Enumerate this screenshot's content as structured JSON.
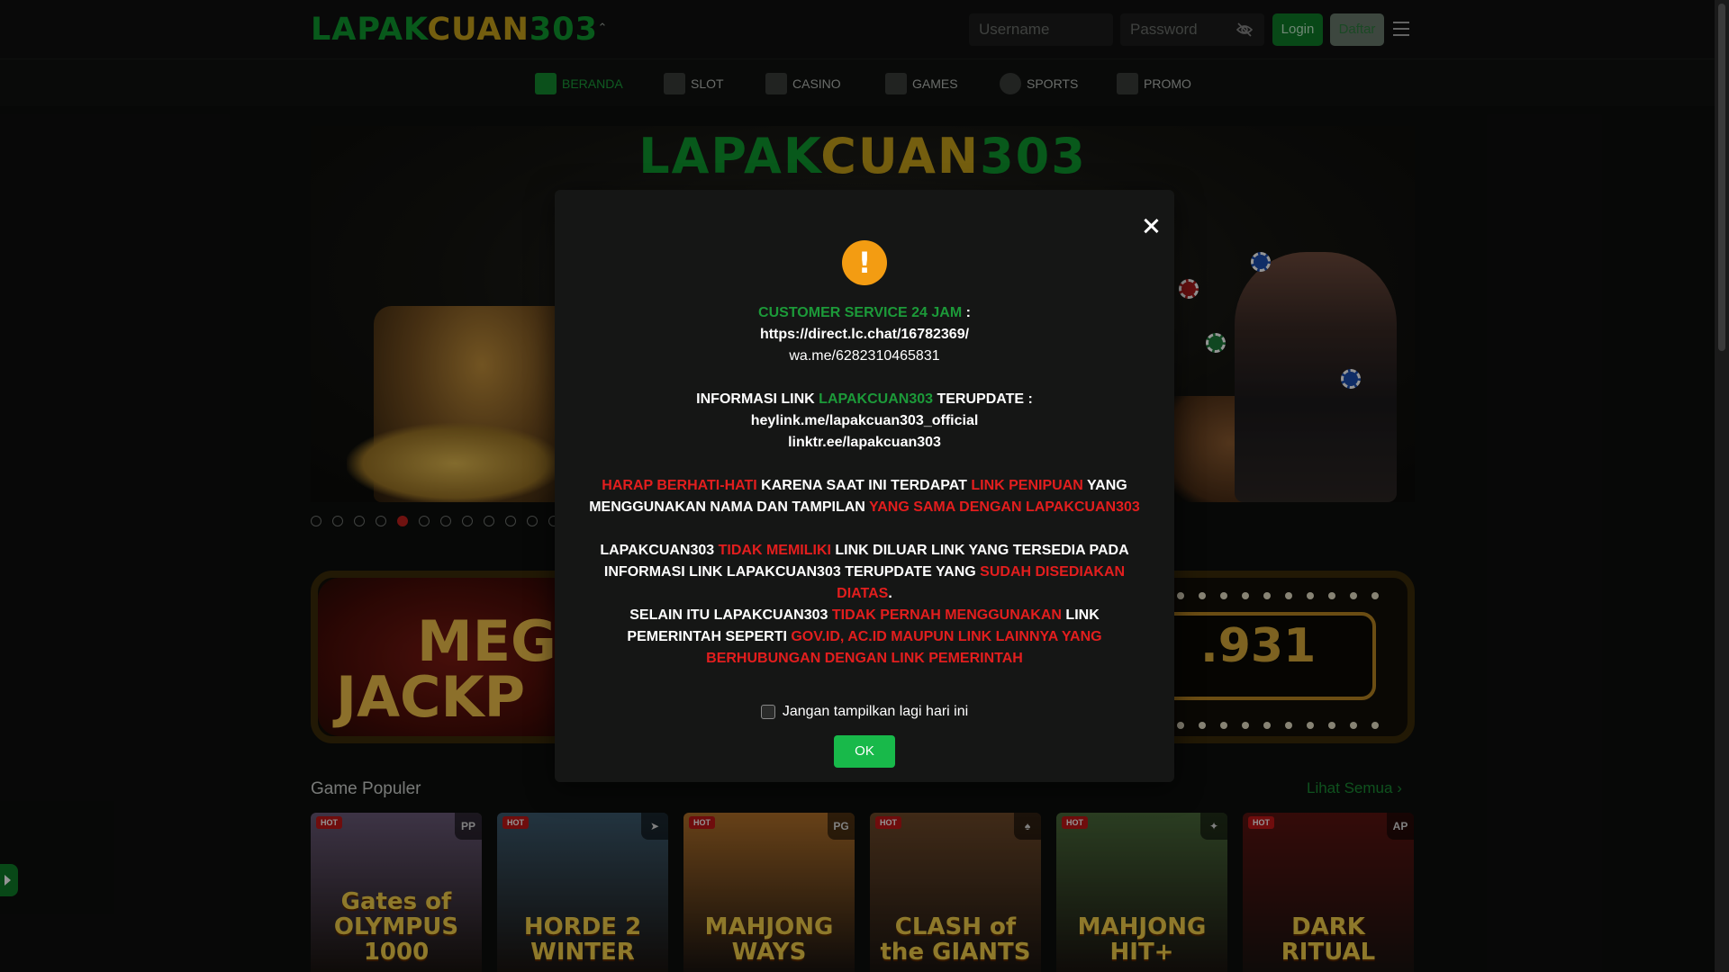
{
  "header": {
    "logo_main": "LAPAK",
    "logo_gold": "CUAN",
    "logo_num": "303",
    "username_placeholder": "Username",
    "password_placeholder": "Password",
    "login_label": "Login",
    "daftar_label": "Daftar"
  },
  "nav": {
    "items": [
      {
        "label": "BERANDA",
        "icon": "home-icon"
      },
      {
        "label": "SLOT",
        "icon": "slot-machine-icon"
      },
      {
        "label": "CASINO",
        "icon": "cards-icon"
      },
      {
        "label": "GAMES",
        "icon": "server-icon"
      },
      {
        "label": "SPORTS",
        "icon": "soccer-ball-icon"
      },
      {
        "label": "PROMO",
        "icon": "percent-ticket-icon"
      }
    ],
    "active": "BERANDA"
  },
  "banner": {
    "logo_main": "LAPAK",
    "logo_gold": "CUAN",
    "logo_num": "303",
    "slide_count": 12,
    "active_slide": 5
  },
  "jackpot": {
    "label_line1": "MEGA",
    "label_line2": "JACKP",
    "value": ".931"
  },
  "popular": {
    "title": "Game Populer",
    "see_all": "Lihat Semua",
    "games": [
      {
        "name": "Gates of OLYMPUS 1000",
        "badge": "HOT",
        "provider": "PP",
        "bg": "#6a5a78"
      },
      {
        "name": "HORDE 2 WINTER",
        "badge": "HOT",
        "provider": "➤",
        "bg": "#3c5a6e"
      },
      {
        "name": "MAHJONG WAYS",
        "badge": "HOT",
        "provider": "PG",
        "bg": "#b2712a"
      },
      {
        "name": "CLASH of the GIANTS",
        "badge": "HOT",
        "provider": "♠",
        "bg": "#6f4a2a"
      },
      {
        "name": "MAHJONG HIT+",
        "badge": "HOT",
        "provider": "✦",
        "bg": "#4a6a3a"
      },
      {
        "name": "DARK RITUAL",
        "badge": "HOT",
        "provider": "AP",
        "bg": "#5a1410"
      }
    ]
  },
  "modal": {
    "cs_label": "CUSTOMER SERVICE 24 JAM",
    "cs_colon": " :",
    "cs_link": "https://direct.lc.chat/16782369/",
    "wa_link": "wa.me/6282310465831",
    "info_pre": "INFORMASI LINK ",
    "info_brand": "LAPAKCUAN303",
    "info_post": " TERUPDATE :",
    "link1": "heylink.me/lapakcuan303_official",
    "link2": "linktr.ee/lapakcuan303",
    "warn_1": "HARAP BERHATI-HATI",
    "warn_2": " KARENA SAAT INI TERDAPAT ",
    "warn_3": "LINK PENIPUAN",
    "warn_4": " YANG MENGGUNAKAN NAMA DAN TAMPILAN ",
    "warn_5": "YANG SAMA DENGAN LAPAKCUAN303",
    "no_1": "LAPAKCUAN303 ",
    "no_2": "TIDAK MEMILIKI",
    "no_3": " LINK DILUAR LINK YANG TERSEDIA PADA INFORMASI LINK LAPAKCUAN303 TERUPDATE YANG ",
    "no_4": "SUDAH DISEDIAKAN DIATAS",
    "no_5": ".",
    "gov_1": "SELAIN ITU LAPAKCUAN303 ",
    "gov_2": "TIDAK PERNAH MENGGUNAKAN",
    "gov_3": " LINK PEMERINTAH SEPERTI ",
    "gov_4": "GOV.ID, AC.ID MAUPUN LINK LAINNYA YANG BERHUBUNGAN DENGAN LINK PEMERINTAH",
    "checkbox_label": "Jangan tampilkan lagi hari ini",
    "ok_label": "OK"
  }
}
